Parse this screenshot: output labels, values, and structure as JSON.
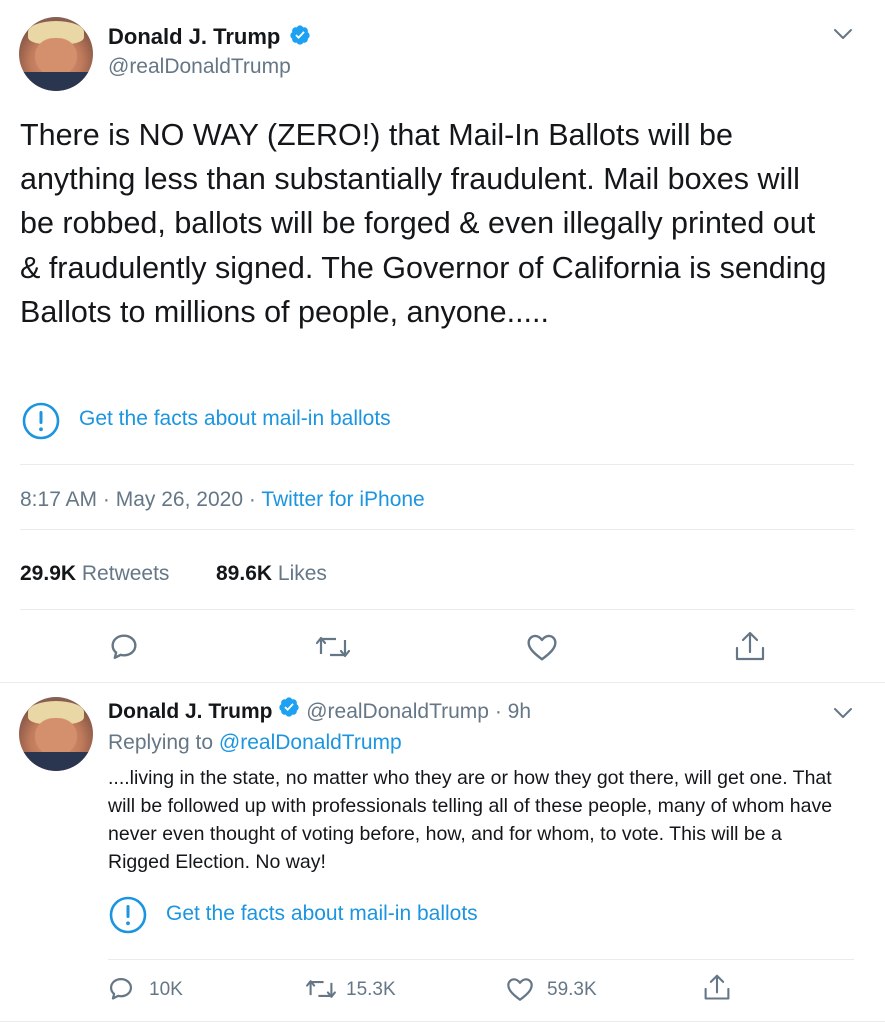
{
  "main_tweet": {
    "author_name": "Donald J. Trump",
    "handle": "@realDonaldTrump",
    "text": "There is NO WAY (ZERO!) that Mail-In Ballots will be anything less than substantially fraudulent. Mail boxes will be robbed, ballots will be forged & even illegally printed out & fraudulently signed. The Governor of California is sending Ballots to millions of people, anyone.....",
    "notice_label": "Get the facts about mail-in ballots",
    "time": "8:17 AM",
    "sep1": "·",
    "date": "May 26, 2020",
    "sep2": "·",
    "source": "Twitter for iPhone",
    "retweets_count": "29.9K",
    "retweets_label": "Retweets",
    "likes_count": "89.6K",
    "likes_label": "Likes"
  },
  "reply_tweet": {
    "author_name": "Donald J. Trump",
    "handle": "@realDonaldTrump",
    "sep": "·",
    "age": "9h",
    "replying_prefix": "Replying to",
    "replying_to": "@realDonaldTrump",
    "text": "....living in the state, no matter who they are or how they got there, will get one. That will be followed up with professionals telling all of these people, many of whom have never even thought of voting before, how, and for whom, to vote. This will be a Rigged Election. No way!",
    "notice_label": "Get the facts about mail-in ballots",
    "reply_count": "10K",
    "retweet_count": "15.3K",
    "like_count": "59.3K"
  },
  "icons": {
    "verified": "verified-badge-icon",
    "caret": "chevron-down-icon",
    "notice": "exclamation-circle-icon",
    "reply": "speech-bubble-icon",
    "retweet": "retweet-arrows-icon",
    "like": "heart-icon",
    "share": "share-upload-icon"
  },
  "colors": {
    "accent": "#1b95e0",
    "text": "#14171a",
    "muted": "#657786",
    "divider": "#e6ecf0"
  }
}
